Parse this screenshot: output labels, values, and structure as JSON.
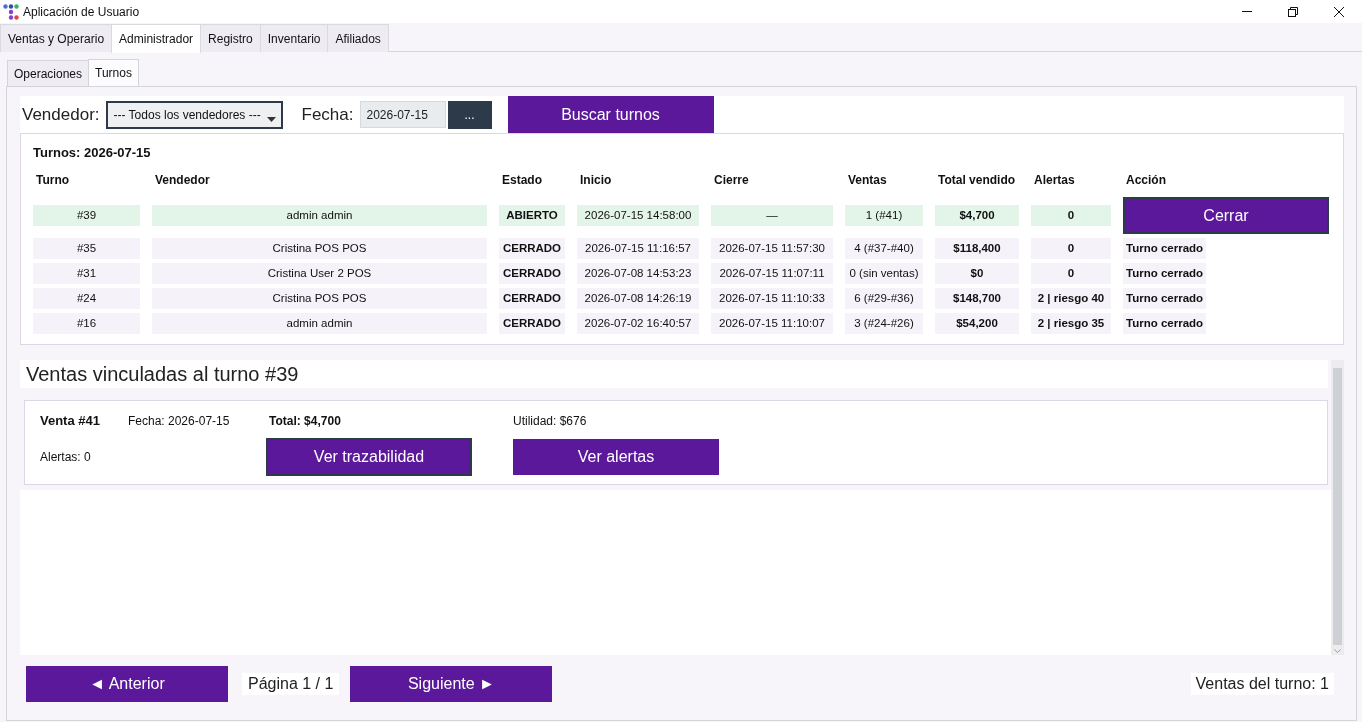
{
  "window": {
    "title": "Aplicación de Usuario"
  },
  "main_tabs": [
    {
      "label": "Ventas y Operario",
      "selected": false
    },
    {
      "label": "Administrador",
      "selected": true
    },
    {
      "label": "Registro",
      "selected": false
    },
    {
      "label": "Inventario",
      "selected": false
    },
    {
      "label": "Afiliados",
      "selected": false
    }
  ],
  "sub_tabs": [
    {
      "label": "Operaciones",
      "selected": false
    },
    {
      "label": "Turnos",
      "selected": true
    }
  ],
  "filters": {
    "vendor_label": "Vendedor:",
    "vendor_value": "--- Todos los vendedores ---",
    "date_label": "Fecha:",
    "date_value": "2026-07-15",
    "date_button": "...",
    "search_button": "Buscar turnos"
  },
  "shifts": {
    "title": "Turnos: 2026-07-15",
    "columns": [
      "Turno",
      "Vendedor",
      "Estado",
      "Inicio",
      "Cierre",
      "Ventas",
      "Total vendido",
      "Alertas",
      "Acción"
    ],
    "rows": [
      {
        "shift": "#39",
        "seller": "admin admin",
        "status": "ABIERTO",
        "start": "2026-07-15 14:58:00",
        "end": "—",
        "sales": "1 (#41)",
        "total": "$4,700",
        "alerts": "0",
        "open": true,
        "action": {
          "kind": "button",
          "label": "Cerrar",
          "focused": true
        }
      },
      {
        "shift": "#35",
        "seller": "Cristina POS POS",
        "status": "CERRADO",
        "start": "2026-07-15 11:16:57",
        "end": "2026-07-15 11:57:30",
        "sales": "4 (#37-#40)",
        "total": "$118,400",
        "alerts": "0",
        "open": false,
        "action": {
          "kind": "text",
          "label": "Turno cerrado"
        }
      },
      {
        "shift": "#31",
        "seller": "Cristina User 2 POS",
        "status": "CERRADO",
        "start": "2026-07-08 14:53:23",
        "end": "2026-07-15 11:07:11",
        "sales": "0 (sin ventas)",
        "total": "$0",
        "alerts": "0",
        "open": false,
        "action": {
          "kind": "text",
          "label": "Turno cerrado"
        }
      },
      {
        "shift": "#24",
        "seller": "Cristina POS POS",
        "status": "CERRADO",
        "start": "2026-07-08 14:26:19",
        "end": "2026-07-15 11:10:33",
        "sales": "6 (#29-#36)",
        "total": "$148,700",
        "alerts": "2 | riesgo 40",
        "open": false,
        "action": {
          "kind": "text",
          "label": "Turno cerrado"
        }
      },
      {
        "shift": "#16",
        "seller": "admin admin",
        "status": "CERRADO",
        "start": "2026-07-02 16:40:57",
        "end": "2026-07-15 11:10:07",
        "sales": "3 (#24-#26)",
        "total": "$54,200",
        "alerts": "2 | riesgo 35",
        "open": false,
        "action": {
          "kind": "text",
          "label": "Turno cerrado"
        }
      }
    ]
  },
  "linked_sales": {
    "title": "Ventas vinculadas al turno #39",
    "sales": [
      {
        "sale": "Venta #41",
        "date": "Fecha: 2026-07-15",
        "total": "Total: $4,700",
        "profit": "Utilidad: $676",
        "alerts": "Alertas: 0",
        "buttons": [
          {
            "label": "Ver trazabilidad",
            "focused": true
          },
          {
            "label": "Ver alertas",
            "focused": false
          }
        ]
      }
    ]
  },
  "pagination": {
    "previous": "◄ Anterior",
    "page": "Página 1 / 1",
    "next": "Siguiente ►",
    "count": "Ventas del turno: 1"
  }
}
